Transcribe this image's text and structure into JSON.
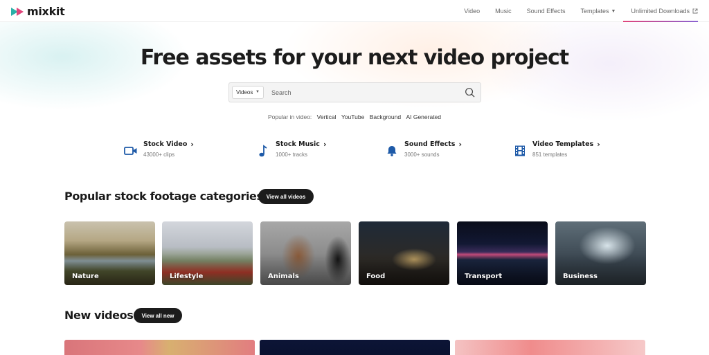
{
  "logo": {
    "text": "mixkit"
  },
  "nav": {
    "items": [
      "Video",
      "Music",
      "Sound Effects"
    ],
    "templates": "Templates",
    "unlimited": "Unlimited Downloads"
  },
  "hero": {
    "title": "Free assets for your next video project",
    "search_type": "Videos",
    "search_placeholder": "Search",
    "popular_label": "Popular in video:",
    "popular_links": [
      "Vertical",
      "YouTube",
      "Background",
      "AI Generated"
    ]
  },
  "assets": [
    {
      "title": "Stock Video",
      "sub": "43000+ clips",
      "icon": "video-camera-icon"
    },
    {
      "title": "Stock Music",
      "sub": "1000+ tracks",
      "icon": "music-note-icon"
    },
    {
      "title": "Sound Effects",
      "sub": "3000+ sounds",
      "icon": "bell-icon"
    },
    {
      "title": "Video Templates",
      "sub": "851 templates",
      "icon": "film-strip-icon"
    }
  ],
  "categories_section": {
    "title": "Popular stock footage categories",
    "button": "View all videos",
    "items": [
      "Nature",
      "Lifestyle",
      "Animals",
      "Food",
      "Transport",
      "Business"
    ]
  },
  "new_videos_section": {
    "title": "New videos",
    "button": "View all new"
  },
  "colors": {
    "accent_teal": "#2ab0a8",
    "accent_pink": "#e0457b",
    "icon_blue": "#1e5aa8",
    "button_dark": "#1c1c1c"
  }
}
